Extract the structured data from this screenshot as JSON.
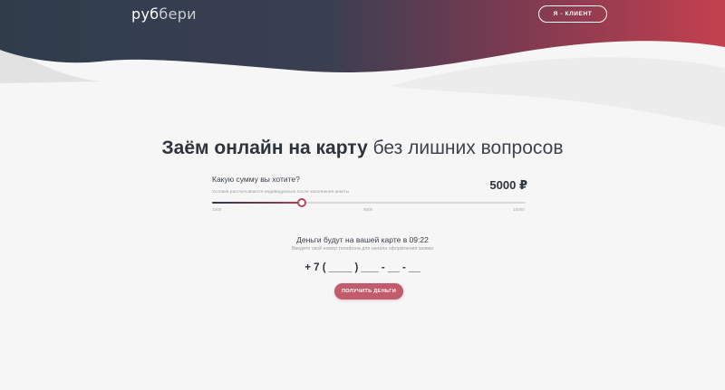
{
  "header": {
    "logo_part1": "руб",
    "logo_part2": "бери",
    "client_button": "Я - КЛИЕНТ"
  },
  "headline": {
    "bold": "Заём онлайн на карту",
    "light": "без лишних вопросов"
  },
  "amount": {
    "question": "Какую сумму вы хотите?",
    "hint": "Условия рассчитываются индивидуально после заполнения анкеты",
    "value": "5000 ₽",
    "slider": {
      "min": 1000,
      "max": 15000,
      "value": 5000,
      "ticks": [
        "1000",
        "8000",
        "15000"
      ]
    }
  },
  "phone": {
    "money_time": "Деньги будут на вашей карте в 09:22",
    "hint": "Введите свой номер телефона для начала оформления заявки",
    "value": "+ 7 ( ____ ) ___ - __ - __"
  },
  "cta": {
    "label": "ПОЛУЧИТЬ ДЕНЬГИ"
  },
  "colors": {
    "header_dark": "#2f3d4b",
    "header_red": "#c4404f",
    "accent": "#c05c6c",
    "background": "#f6f6f6"
  }
}
